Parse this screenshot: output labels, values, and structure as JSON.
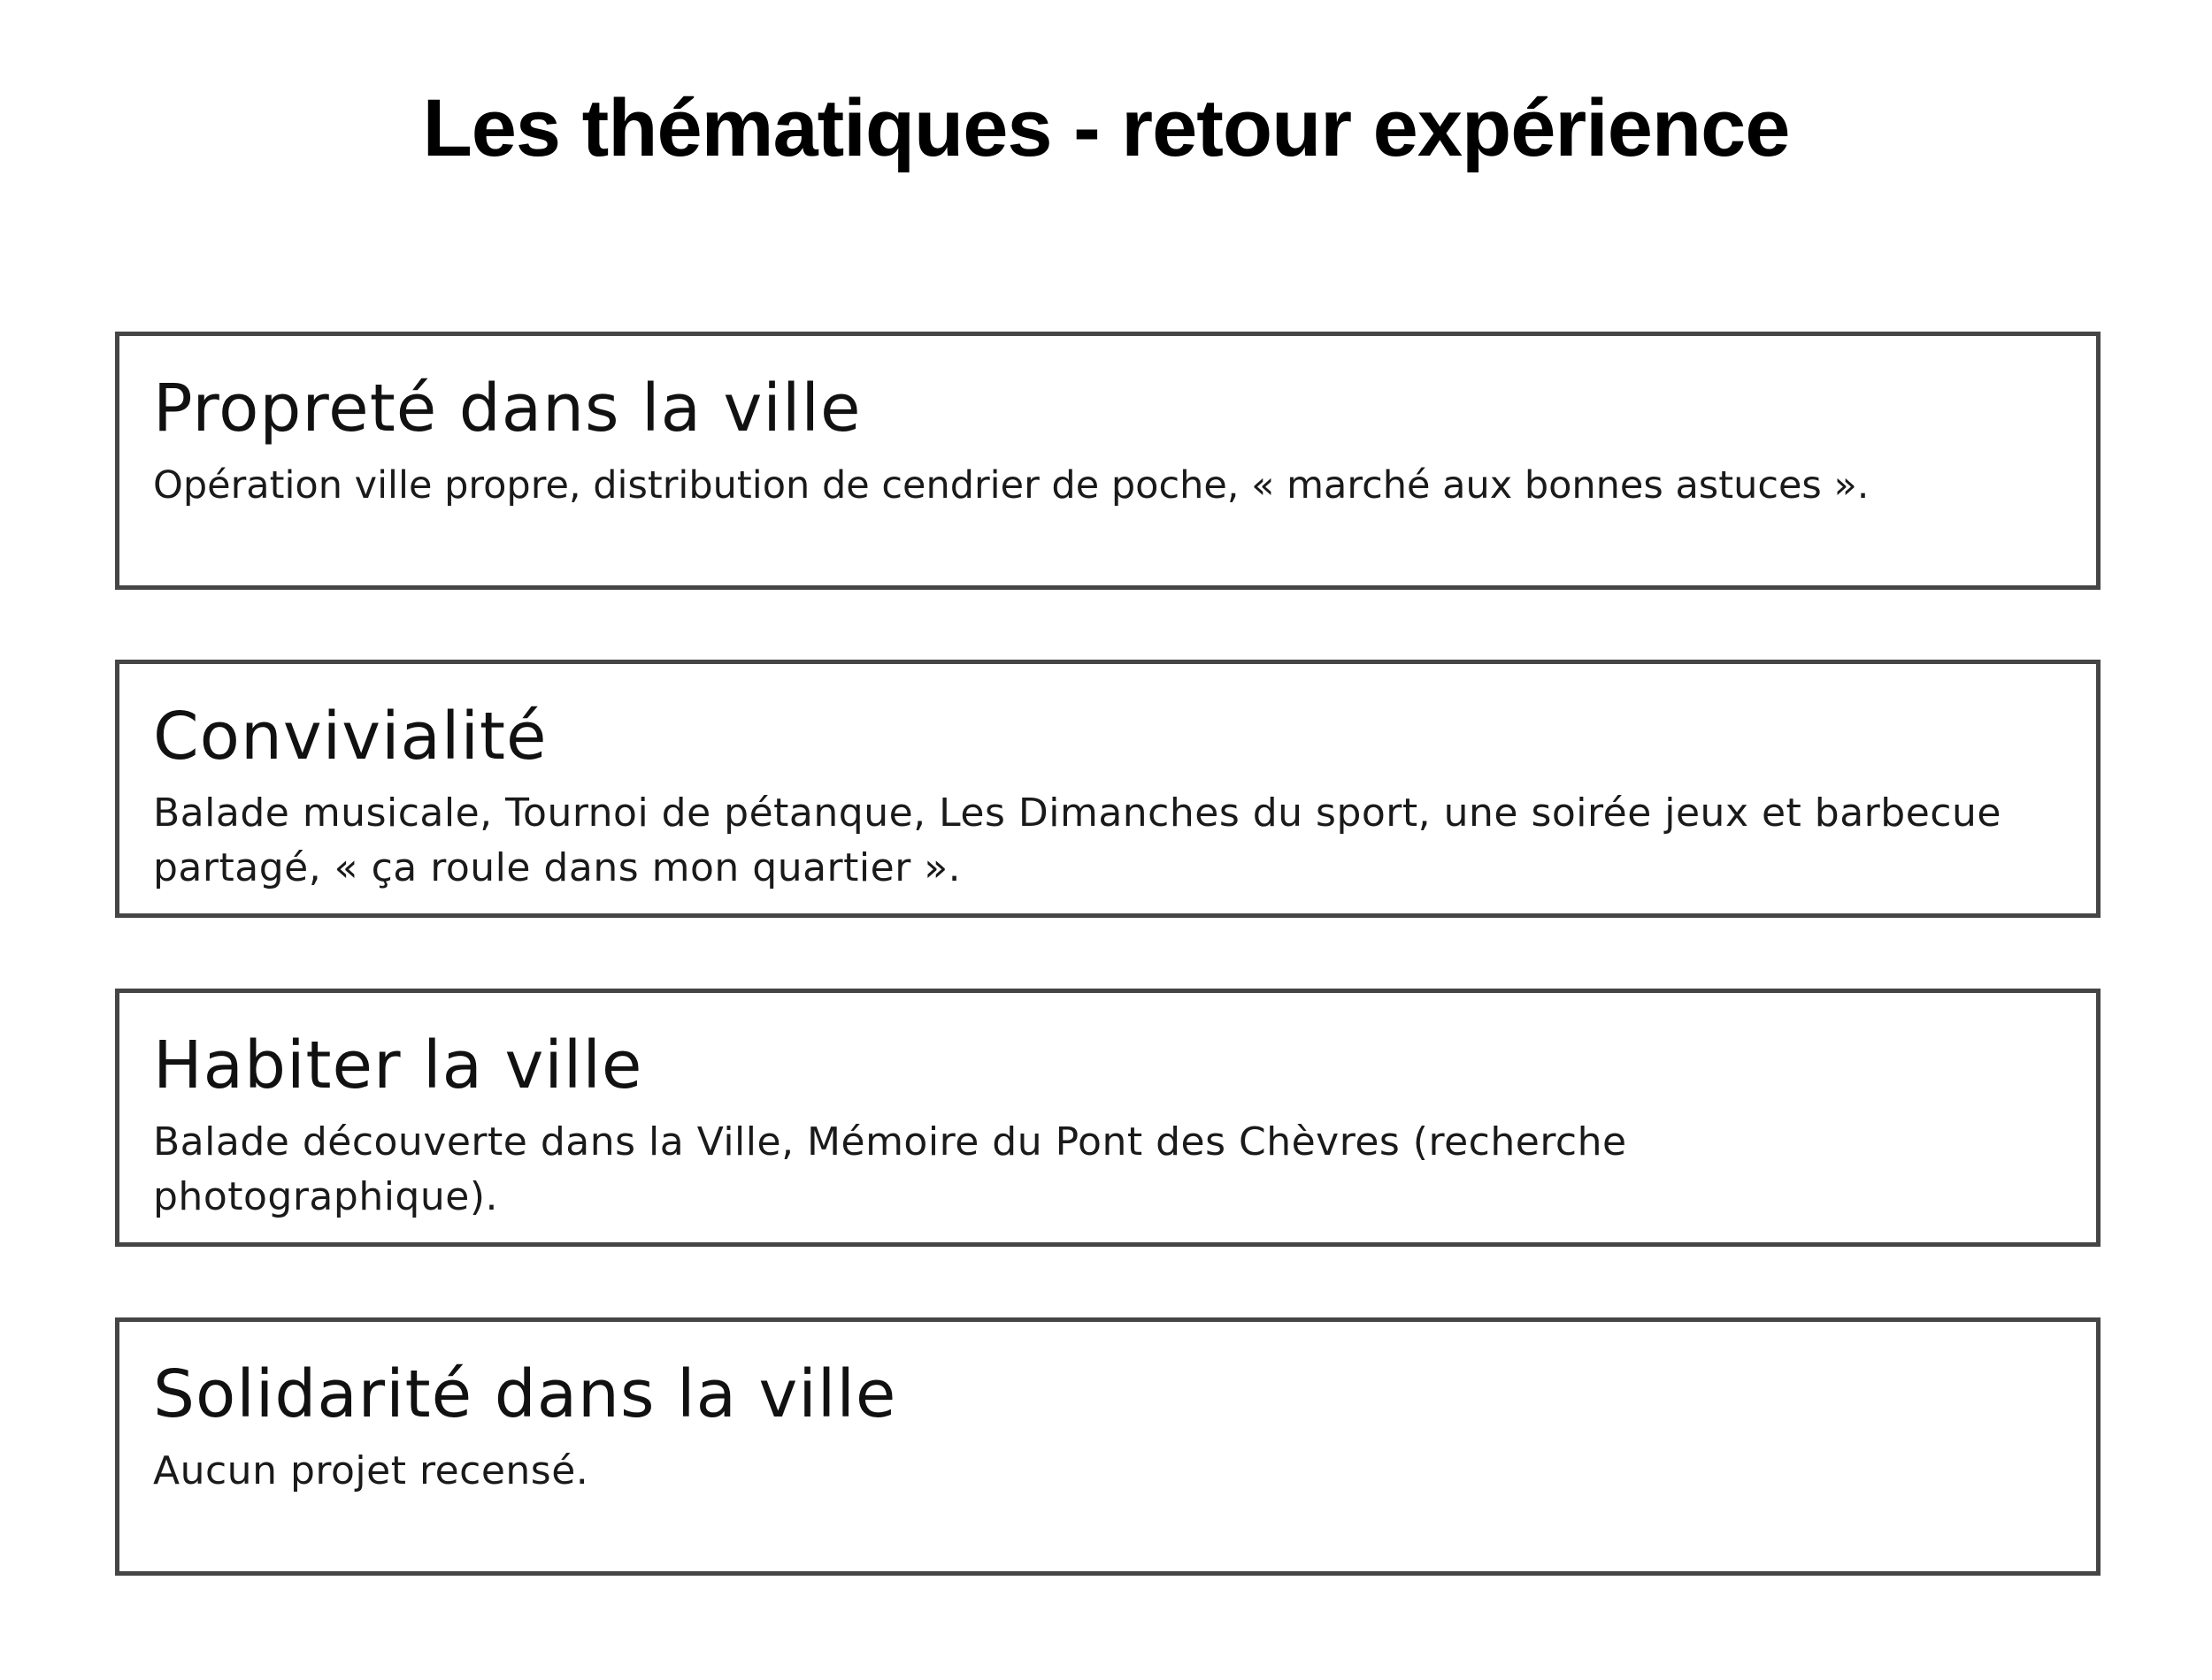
{
  "page": {
    "title": "Les thématiques - retour expérience"
  },
  "themes": [
    {
      "heading": "Propreté dans la ville",
      "text": "Opération ville propre, distribution de cendrier de poche, « marché aux bonnes astuces »."
    },
    {
      "heading": "Convivialité",
      "text": "Balade musicale, Tournoi de pétanque, Les Dimanches du sport, une soirée jeux et barbecue partagé, « ça roule dans mon quartier »."
    },
    {
      "heading": "Habiter la ville",
      "text": "Balade découverte dans la Ville, Mémoire du Pont des Chèvres (recherche photographique)."
    },
    {
      "heading": "Solidarité dans la ville",
      "text": "Aucun projet recensé."
    }
  ],
  "colors": {
    "border": "#454545",
    "text": "#111111",
    "background": "#ffffff"
  }
}
